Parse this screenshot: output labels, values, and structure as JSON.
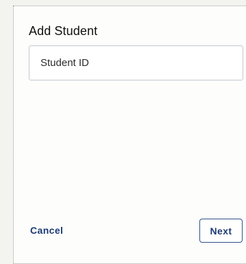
{
  "dialog": {
    "title": "Add Student",
    "student_id_field": {
      "placeholder": "Student ID",
      "value": ""
    },
    "cancel_label": "Cancel",
    "next_label": "Next"
  },
  "colors": {
    "accent": "#1b3a73",
    "button_border": "#2f4f86",
    "field_border": "#c2c7cf",
    "dialog_background": "#fdfdfc"
  }
}
